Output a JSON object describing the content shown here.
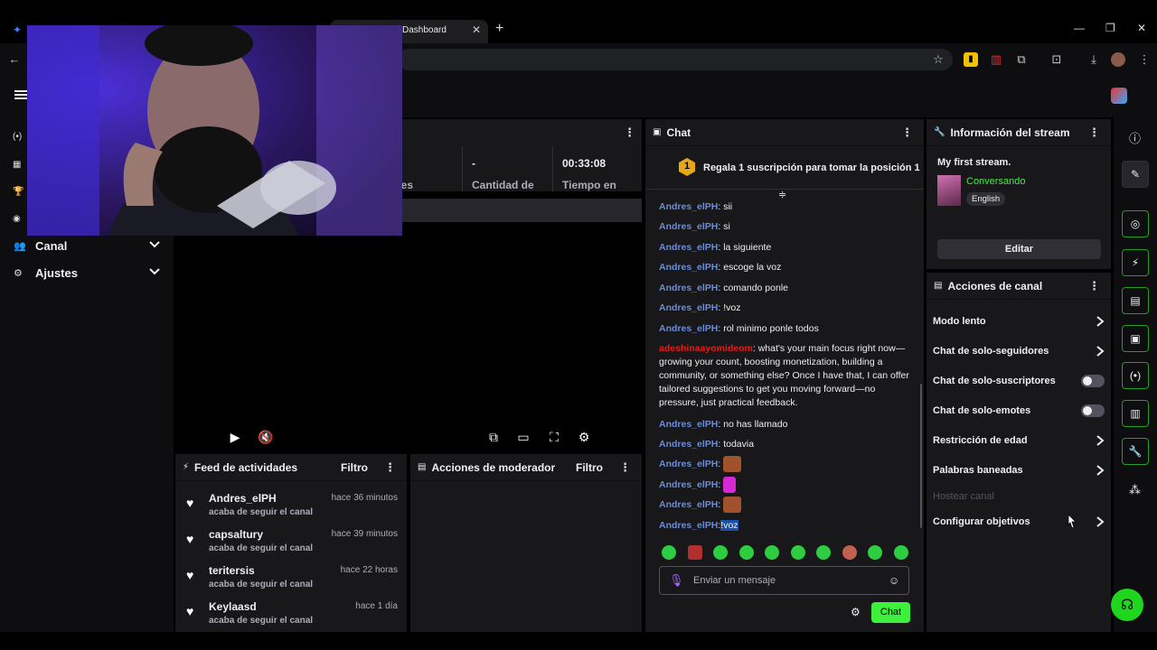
{
  "browser": {
    "tab_title": "Dashboard",
    "tab_close": "✕",
    "new_tab": "+"
  },
  "nav": {
    "items": [
      {
        "label": "Canal"
      },
      {
        "label": "Ajustes"
      }
    ]
  },
  "stats": [
    {
      "value": "",
      "label": "idores"
    },
    {
      "value": "-",
      "label": "Cantidad de"
    },
    {
      "value": "00:33:08",
      "label": "Tiempo en"
    }
  ],
  "feed": {
    "title": "Feed de actividades",
    "filter": "Filtro",
    "items": [
      {
        "name": "Andres_elPH",
        "sub": "acaba de seguir el canal",
        "time": "hace 36 minutos"
      },
      {
        "name": "capsaltury",
        "sub": "acaba de seguir el canal",
        "time": "hace 39 minutos"
      },
      {
        "name": "teritersis",
        "sub": "acaba de seguir el canal",
        "time": "hace 22 horas"
      },
      {
        "name": "Keylaasd",
        "sub": "acaba de seguir el canal",
        "time": "hace 1 día"
      }
    ]
  },
  "modactions": {
    "title": "Acciones de moderador",
    "filter": "Filtro"
  },
  "chat": {
    "title": "Chat",
    "gift_rank": "1",
    "gift_text": "Regala 1 suscripción para tomar la posición 1",
    "messages": [
      {
        "user": "Andres_elPH",
        "text": ": sii"
      },
      {
        "user": "Andres_elPH",
        "text": ": si"
      },
      {
        "user": "Andres_elPH",
        "text": ": la siguiente"
      },
      {
        "user": "Andres_elPH",
        "text": ": escoge la voz"
      },
      {
        "user": "Andres_elPH",
        "text": ": comando ponle"
      },
      {
        "user": "Andres_elPH",
        "text": ": !voz"
      },
      {
        "user": "Andres_elPH",
        "text": ": rol minimo ponle todos"
      },
      {
        "user": "adeshinaayomideom",
        "text": ": what's your main focus right now—growing your count, boosting monetization, building a community, or something else? Once I have that, I can offer tailored suggestions to get you moving forward—no pressure, just practical feedback."
      },
      {
        "user": "Andres_elPH",
        "text": ": no has llamado"
      },
      {
        "user": "Andres_elPH",
        "text": ": todavia"
      },
      {
        "user": "Andres_elPH",
        "text": ":"
      },
      {
        "user": "Andres_elPH",
        "text": ":"
      },
      {
        "user": "Andres_elPH",
        "text": ":"
      },
      {
        "user": "Andres_elPH",
        "text": ":",
        "highlight": "!voz"
      }
    ],
    "input_placeholder": "Enviar un mensaje",
    "send_label": "Chat",
    "accent": "#3cf03c"
  },
  "stream_info": {
    "title": "Información del stream",
    "stream_title": "My first stream.",
    "category": "Conversando",
    "language": "English",
    "edit_label": "Editar"
  },
  "channel_actions": {
    "title": "Acciones de canal",
    "items": [
      {
        "label": "Modo lento",
        "control": "chevron"
      },
      {
        "label": "Chat de solo-seguidores",
        "control": "chevron"
      },
      {
        "label": "Chat de solo-suscriptores",
        "control": "toggle"
      },
      {
        "label": "Chat de solo-emotes",
        "control": "toggle"
      },
      {
        "label": "Restricción de edad",
        "control": "chevron"
      },
      {
        "label": "Palabras baneadas",
        "control": "chevron"
      },
      {
        "label": "Hostear canal",
        "control": "none",
        "disabled": true
      },
      {
        "label": "Configurar objetivos",
        "control": "chevron"
      }
    ]
  },
  "colors": {
    "panel": "#18181b",
    "background": "#0e0e10",
    "green": "#3cf03c",
    "username": "#6b8cd4"
  }
}
